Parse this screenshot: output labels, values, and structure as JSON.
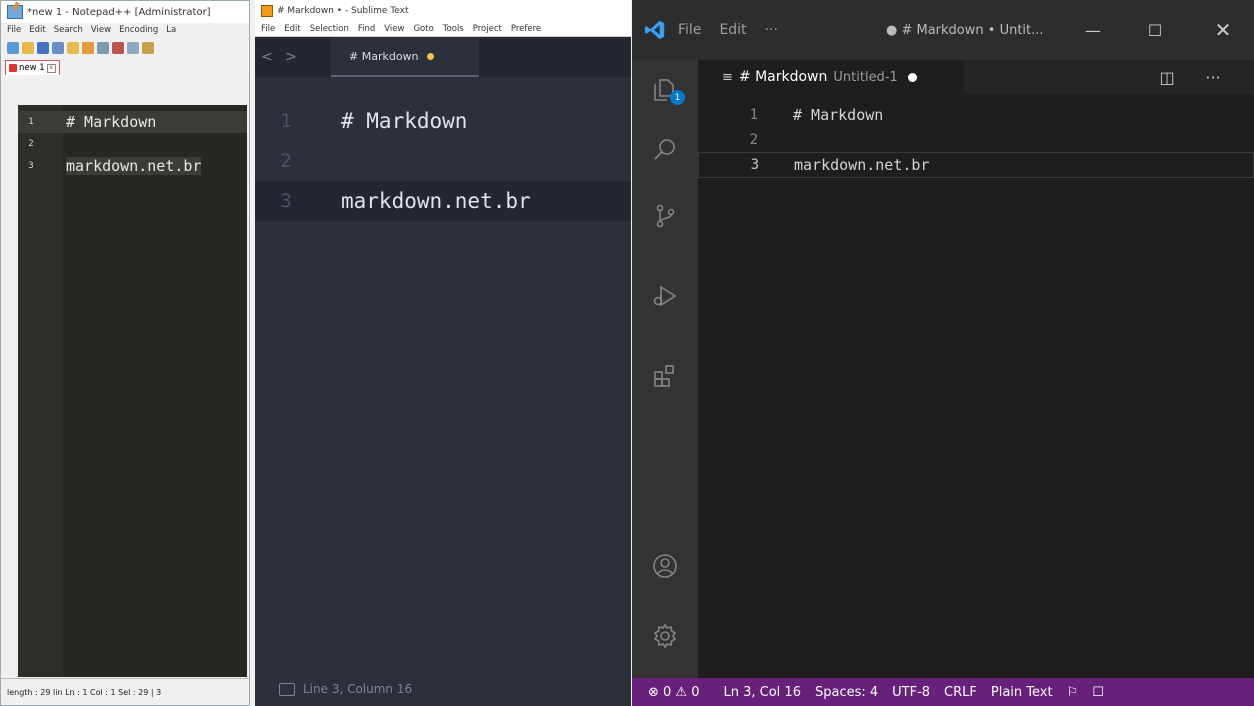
{
  "notepadpp": {
    "title": "*new 1 - Notepad++ [Administrator]",
    "menu": [
      "File",
      "Edit",
      "Search",
      "View",
      "Encoding",
      "La"
    ],
    "tab_label": "new 1",
    "tab_close": "x",
    "lines": [
      {
        "num": "1",
        "text": "# Markdown"
      },
      {
        "num": "2",
        "text": ""
      },
      {
        "num": "3",
        "text": "markdown.net.br"
      }
    ],
    "status": "length : 29    lin Ln : 1    Col : 1    Sel : 29 | 3"
  },
  "sublime": {
    "title": "# Markdown • - Sublime Text",
    "menu": [
      "File",
      "Edit",
      "Selection",
      "Find",
      "View",
      "Goto",
      "Tools",
      "Project",
      "Prefere"
    ],
    "nav_back": "<",
    "nav_forward": ">",
    "tab_label": "# Markdown",
    "lines": [
      {
        "num": "1",
        "text": "# Markdown"
      },
      {
        "num": "2",
        "text": ""
      },
      {
        "num": "3",
        "text": "markdown.net.br"
      }
    ],
    "status": "Line 3, Column 16"
  },
  "vscode": {
    "menu": [
      "File",
      "Edit",
      "···"
    ],
    "window_title": "● # Markdown • Untit...",
    "tab_label": "# Markdown",
    "tab_sub": "Untitled-1",
    "explorer_badge": "1",
    "more_actions": "···",
    "lines": [
      {
        "num": "1",
        "text": "# Markdown"
      },
      {
        "num": "2",
        "text": ""
      },
      {
        "num": "3",
        "text": "markdown.net.br"
      }
    ],
    "status": {
      "problems": "⊗ 0 ⚠ 0",
      "position": "Ln 3, Col 16",
      "spaces": "Spaces: 4",
      "encoding": "UTF-8",
      "eol": "CRLF",
      "language": "Plain Text"
    }
  }
}
